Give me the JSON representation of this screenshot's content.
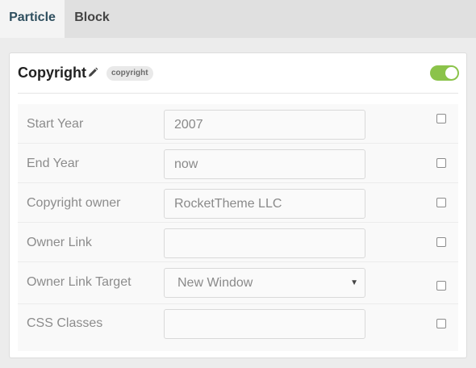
{
  "tabs": [
    {
      "label": "Particle",
      "active": true
    },
    {
      "label": "Block",
      "active": false
    }
  ],
  "particle": {
    "title": "Copyright",
    "badge": "copyright",
    "enabled": true,
    "toggle_color": "#8bc34a",
    "edit_icon": "pencil-icon"
  },
  "fields": {
    "start_year": {
      "label": "Start Year",
      "value": "2007",
      "override": false
    },
    "end_year": {
      "label": "End Year",
      "value": "now",
      "override": false
    },
    "copyright_owner": {
      "label": "Copyright owner",
      "value": "RocketTheme LLC",
      "override": false
    },
    "owner_link": {
      "label": "Owner Link",
      "value": "",
      "override": false
    },
    "owner_link_target": {
      "label": "Owner Link Target",
      "value": "New Window",
      "override": false
    },
    "css_classes": {
      "label": "CSS Classes",
      "value": "",
      "override": false
    }
  }
}
